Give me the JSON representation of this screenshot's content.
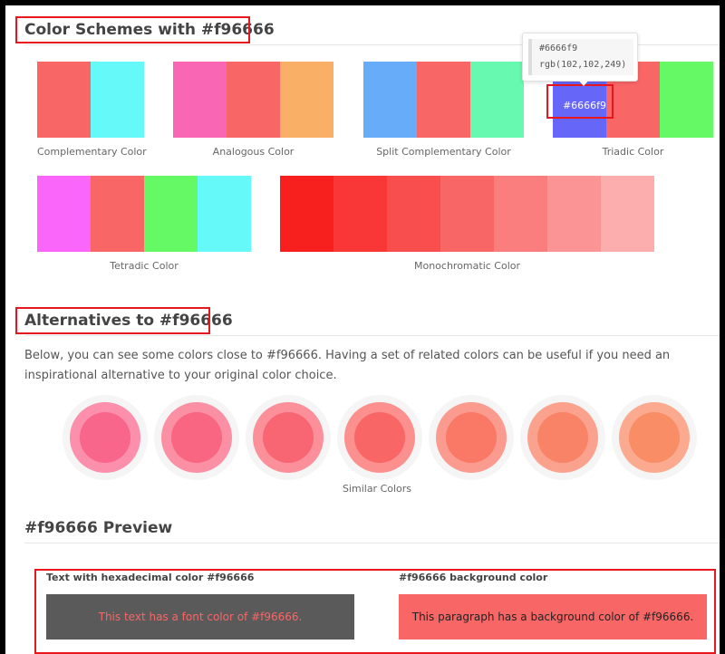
{
  "color_schemes": {
    "title": "Color Schemes with #f96666",
    "schemes": [
      {
        "label": "Complementary Color",
        "colors": [
          "#f96666",
          "#66f9f9"
        ]
      },
      {
        "label": "Analogous Color",
        "colors": [
          "#f966b3",
          "#f96666",
          "#f9af66"
        ]
      },
      {
        "label": "Split Complementary Color",
        "colors": [
          "#66acf9",
          "#f96666",
          "#66f9af"
        ]
      },
      {
        "label": "Triadic Color",
        "colors": [
          "#6666f9",
          "#f96666",
          "#66f966"
        ]
      },
      {
        "label": "Tetradic Color",
        "colors": [
          "#f966f9",
          "#f96666",
          "#66f966",
          "#66f9f9"
        ]
      },
      {
        "label": "Monochromatic Color",
        "colors": [
          "#f81f1f",
          "#f93737",
          "#f94e4e",
          "#f96666",
          "#fa7e7e",
          "#fb9595",
          "#fcadad"
        ]
      }
    ],
    "tooltip": {
      "hex": "#6666f9",
      "rgb": "rgb(102,102,249)"
    },
    "hovered_swatch_label": "#6666f9"
  },
  "alternatives": {
    "title": "Alternatives to #f96666",
    "description": "Below, you can see some colors close to #f96666. Having a set of related colors can be useful if you need an inspirational alternative to your original color choice.",
    "caption": "Similar Colors",
    "circles": [
      {
        "outer": "#fb8fac",
        "inner": "#f9668b"
      },
      {
        "outer": "#fb8fa4",
        "inner": "#f96681"
      },
      {
        "outer": "#fb8f9a",
        "inner": "#f96673"
      },
      {
        "outer": "#fb908f",
        "inner": "#f96666"
      },
      {
        "outer": "#fb9a8f",
        "inner": "#f97866"
      },
      {
        "outer": "#fba28f",
        "inner": "#f98366"
      },
      {
        "outer": "#fbaa8f",
        "inner": "#f98e66"
      }
    ]
  },
  "preview": {
    "title": "#f96666 Preview",
    "text_column_title": "Text with hexadecimal color #f96666",
    "text_sample": "This text has a font color of #f96666.",
    "bg_column_title": "#f96666 background color",
    "bg_sample": "This paragraph has a background color of #f96666.",
    "color": "#f96666"
  }
}
